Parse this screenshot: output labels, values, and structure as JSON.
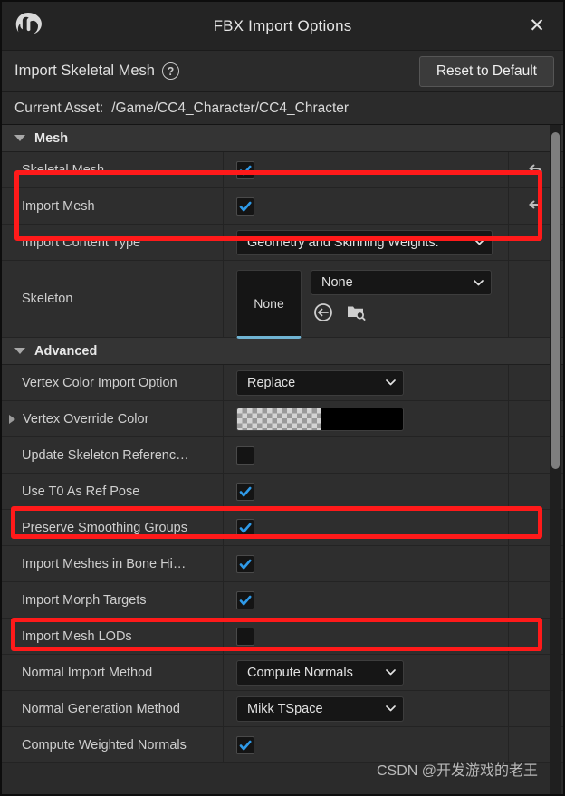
{
  "window": {
    "title": "FBX Import Options",
    "logo_icon": "unreal-engine-logo",
    "close_icon": "close-icon"
  },
  "subheader": {
    "title": "Import Skeletal Mesh",
    "help_icon": "help-question-icon",
    "reset_button": "Reset to Default"
  },
  "current_asset": {
    "label": "Current Asset:",
    "path": "/Game/CC4_Character/CC4_Chracter"
  },
  "sections": [
    {
      "name": "Mesh",
      "expanded": true
    },
    {
      "name": "Advanced",
      "expanded": true
    }
  ],
  "rows": {
    "skeletal_mesh": {
      "label": "Skeletal Mesh",
      "value": "checked"
    },
    "import_mesh": {
      "label": "Import Mesh",
      "value": "checked"
    },
    "import_content_type": {
      "label": "Import Content Type",
      "value": "Geometry and Skinning Weights."
    },
    "skeleton": {
      "label": "Skeleton",
      "thumbnail": "None",
      "value": "None"
    },
    "vertex_color_import": {
      "label": "Vertex Color Import Option",
      "value": "Replace"
    },
    "vertex_override_color": {
      "label": "Vertex Override Color",
      "value": "#000000"
    },
    "update_skeleton_ref": {
      "label": "Update Skeleton Referenc…",
      "value": "unchecked"
    },
    "use_t0_as_ref_pose": {
      "label": "Use T0 As Ref Pose",
      "value": "checked"
    },
    "preserve_smoothing": {
      "label": "Preserve Smoothing Groups",
      "value": "checked"
    },
    "import_meshes_bone": {
      "label": "Import Meshes in Bone Hi…",
      "value": "checked"
    },
    "import_morph_targets": {
      "label": "Import Morph Targets",
      "value": "checked"
    },
    "import_mesh_lods": {
      "label": "Import Mesh LODs",
      "value": "unchecked"
    },
    "normal_import_method": {
      "label": "Normal Import Method",
      "value": "Compute Normals"
    },
    "normal_generation_method": {
      "label": "Normal Generation Method",
      "value": "Mikk TSpace"
    },
    "compute_weighted_normals": {
      "label": "Compute Weighted Normals",
      "value": "checked"
    }
  },
  "icons": {
    "reset_arrow": "undo-arrow-icon",
    "use_selected_asset": "use-selected-asset-icon",
    "browse_asset": "browse-to-asset-icon",
    "chevron_down": "chevron-down-icon",
    "expander_collapsed": "triangle-right-icon",
    "expander_expanded": "triangle-down-icon"
  },
  "colors": {
    "accent_blue": "#2f9ae8",
    "annotation_red": "#ff1a1a",
    "thumbnail_underline": "#6fb3d2"
  },
  "watermark": "CSDN @开发游戏的老王"
}
